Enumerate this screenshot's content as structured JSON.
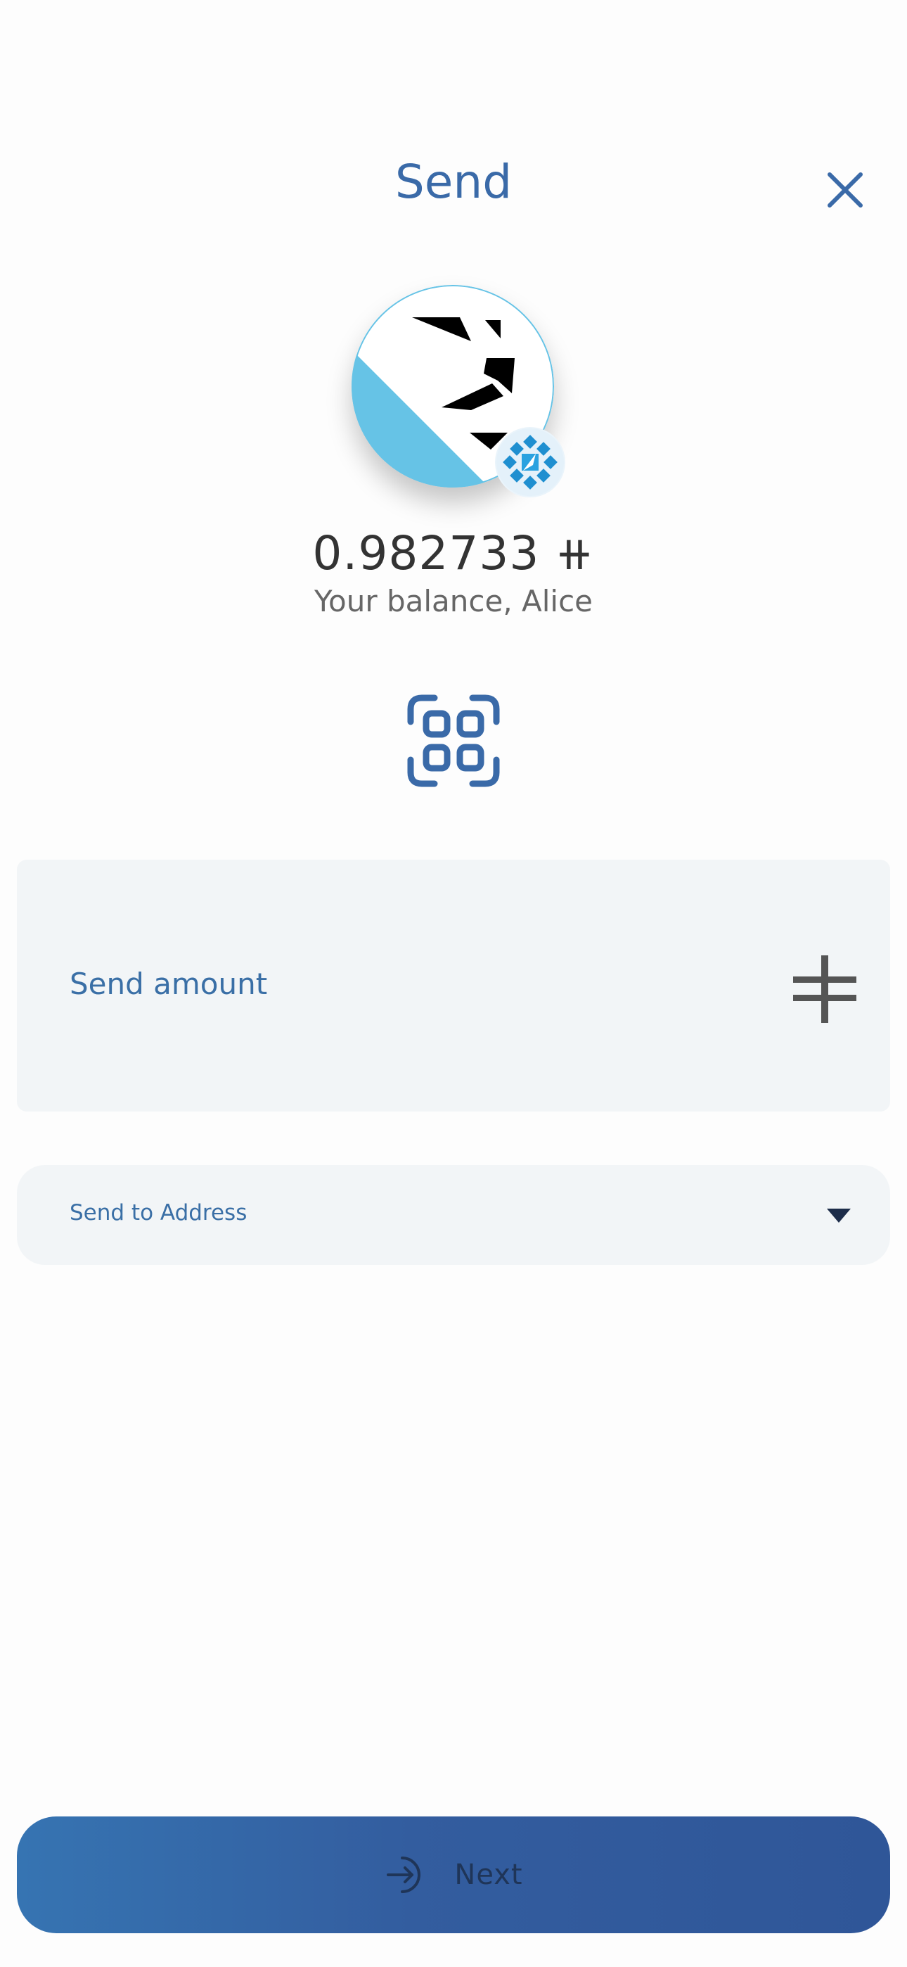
{
  "header": {
    "title": "Send",
    "close_icon": "close-icon"
  },
  "account": {
    "avatar_icon": "lion-avatar",
    "badge_icon": "network-badge-icon",
    "balance_value": "0.982733 ⧺",
    "balance_caption": "Your balance, Alice"
  },
  "actions": {
    "qr_icon": "qr-scan-icon"
  },
  "amount": {
    "label": "Send amount",
    "currency_icon": "currency-symbol-icon"
  },
  "address": {
    "label": "Send to Address",
    "caret_icon": "chevron-down-icon"
  },
  "footer": {
    "next_label": "Next",
    "next_icon": "arrow-in-icon"
  },
  "colors": {
    "accent": "#3a6aa8",
    "card_background": "#f2f5f7",
    "button_gradient_start": "#3674b2",
    "button_gradient_end": "#2f5698",
    "avatar_blue": "#66c3e6"
  }
}
